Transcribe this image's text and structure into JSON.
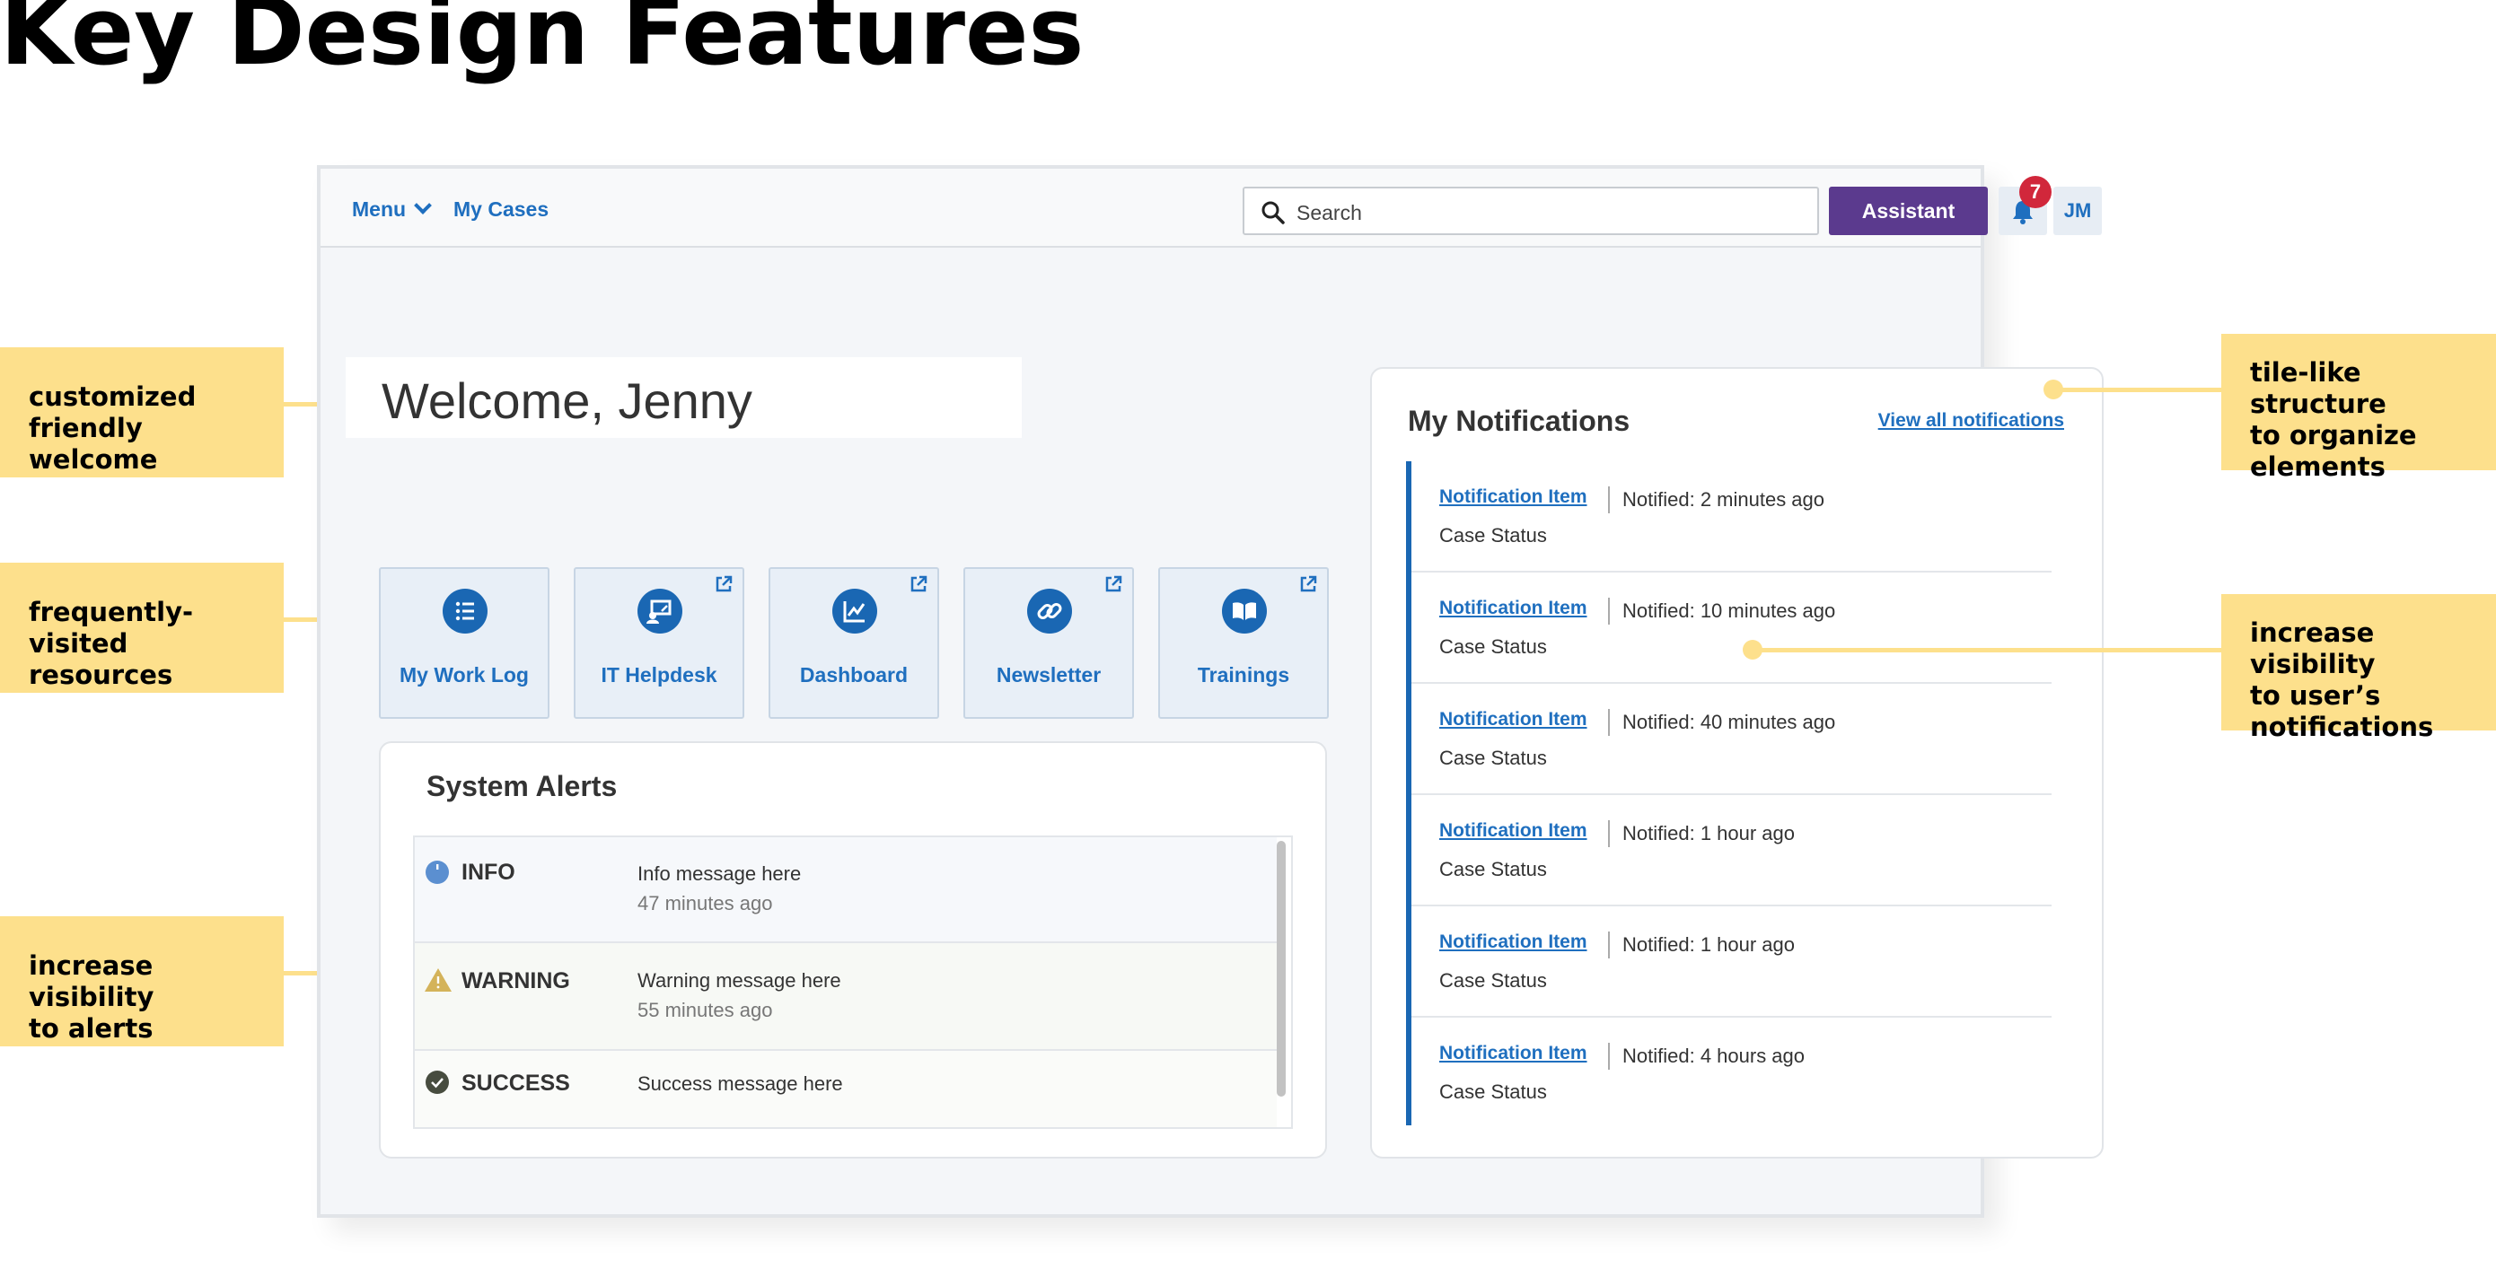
{
  "page_title": "Key Design Features",
  "callouts": [
    {
      "id": "welcome",
      "text": "customized\nfriendly welcome"
    },
    {
      "id": "resources",
      "text": "frequently-visited\nresources"
    },
    {
      "id": "alerts",
      "text": "increase visibility\nto alerts"
    },
    {
      "id": "tiles",
      "text": "tile-like structure\nto organize\nelements"
    },
    {
      "id": "notifications",
      "text": "increase visibility\nto user’s\nnotifications"
    }
  ],
  "colors": {
    "callout": "#fde08c",
    "link": "#1f6fbf",
    "assistant": "#5b3a8e",
    "badge": "#d1273b",
    "tile_bg": "#e8eff7",
    "accent_bar": "#1a67b3"
  },
  "topbar": {
    "menu_label": "Menu",
    "my_cases_label": "My Cases",
    "search_placeholder": "Search",
    "assistant_label": "Assistant",
    "notification_count": "7",
    "avatar_initials": "JM"
  },
  "welcome": {
    "text": "Welcome, Jenny"
  },
  "tiles": [
    {
      "label": "My Work Log",
      "icon": "list-icon",
      "external": false
    },
    {
      "label": "IT Helpdesk",
      "icon": "helpdesk-icon",
      "external": true
    },
    {
      "label": "Dashboard",
      "icon": "chart-icon",
      "external": true
    },
    {
      "label": "Newsletter",
      "icon": "link-icon",
      "external": true
    },
    {
      "label": "Trainings",
      "icon": "book-icon",
      "external": true
    }
  ],
  "system_alerts": {
    "title": "System Alerts",
    "items": [
      {
        "type": "INFO",
        "message": "Info message here",
        "time": "47 minutes ago",
        "icon": "info-icon"
      },
      {
        "type": "WARNING",
        "message": "Warning message here",
        "time": "55 minutes ago",
        "icon": "warning-icon"
      },
      {
        "type": "SUCCESS",
        "message": "Success message here",
        "time": "",
        "icon": "check-icon"
      }
    ]
  },
  "notifications": {
    "title": "My Notifications",
    "view_all_label": "View all notifications",
    "items": [
      {
        "link": "Notification Item",
        "time": "Notified: 2 minutes ago",
        "status": "Case Status"
      },
      {
        "link": "Notification Item",
        "time": "Notified: 10 minutes ago",
        "status": "Case Status"
      },
      {
        "link": "Notification Item",
        "time": "Notified: 40 minutes ago",
        "status": "Case Status"
      },
      {
        "link": "Notification Item",
        "time": "Notified: 1 hour ago",
        "status": "Case Status"
      },
      {
        "link": "Notification Item",
        "time": "Notified: 1 hour ago",
        "status": "Case Status"
      },
      {
        "link": "Notification Item",
        "time": "Notified: 4 hours ago",
        "status": "Case Status"
      }
    ]
  }
}
